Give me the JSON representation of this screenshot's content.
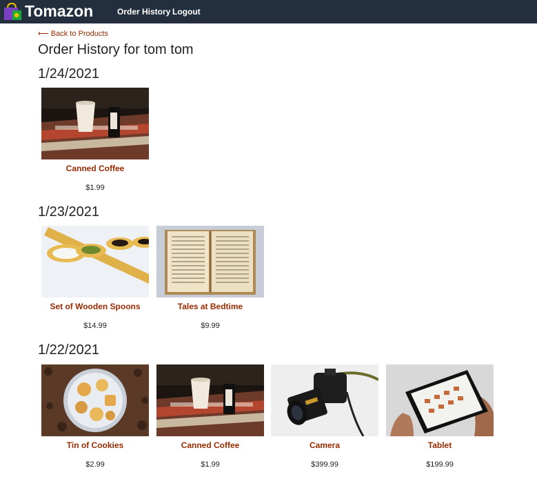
{
  "header": {
    "brand": "Tomazon",
    "nav": [
      {
        "label": "Order History"
      },
      {
        "label": "Logout"
      }
    ]
  },
  "back_link": "Back to Products",
  "page_title": "Order History for tom tom",
  "orders": [
    {
      "date": "1/24/2021",
      "items": [
        {
          "name": "Canned Coffee",
          "price": "$1.99"
        }
      ]
    },
    {
      "date": "1/23/2021",
      "items": [
        {
          "name": "Set of Wooden Spoons",
          "price": "$14.99"
        },
        {
          "name": "Tales at Bedtime",
          "price": "$9.99"
        }
      ]
    },
    {
      "date": "1/22/2021",
      "items": [
        {
          "name": "Tin of Cookies",
          "price": "$2.99"
        },
        {
          "name": "Canned Coffee",
          "price": "$1.99"
        },
        {
          "name": "Camera",
          "price": "$399.99"
        },
        {
          "name": "Tablet",
          "price": "$199.99"
        }
      ]
    }
  ],
  "colors": {
    "navbar": "#232f3e",
    "link": "#9c2a00",
    "text": "#222222"
  }
}
